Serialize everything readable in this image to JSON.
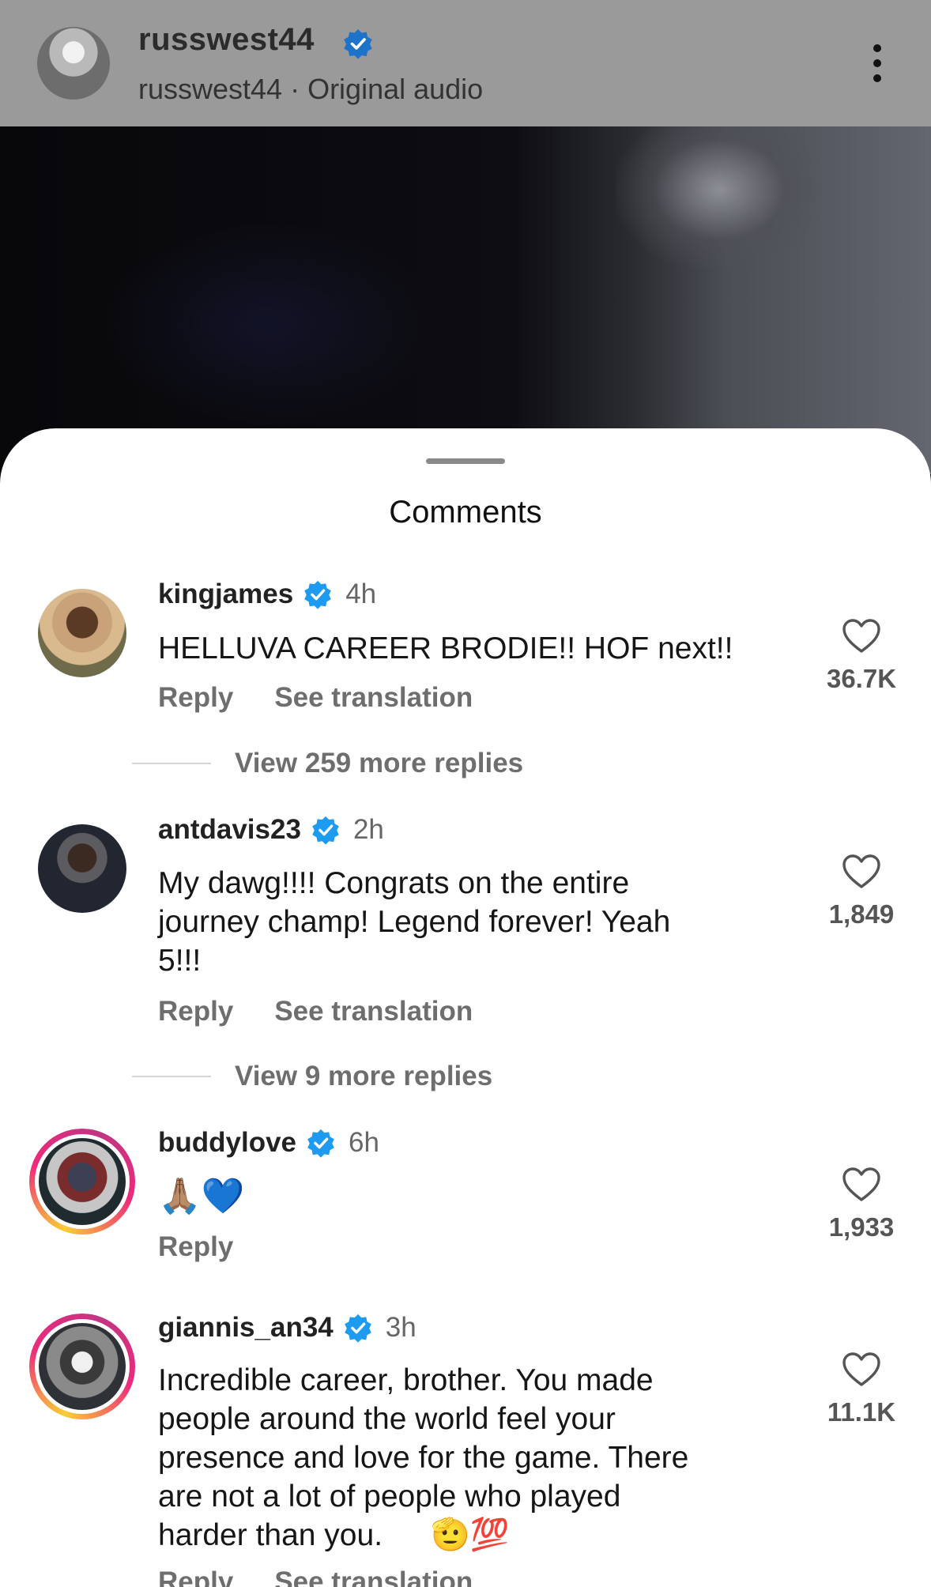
{
  "header": {
    "username": "russwest44",
    "subtitle": "russwest44 · Original audio"
  },
  "sheet": {
    "title": "Comments"
  },
  "comments": [
    {
      "username": "kingjames",
      "time": "4h",
      "text": "HELLUVA CAREER BRODIE!! HOF next!!",
      "reply_label": "Reply",
      "translate_label": "See translation",
      "likes": "36.7K",
      "view_replies": "View 259 more replies"
    },
    {
      "username": "antdavis23",
      "time": "2h",
      "text": "My dawg!!!! Congrats on the entire\njourney champ! Legend forever! Yeah\n5!!!",
      "reply_label": "Reply",
      "translate_label": "See translation",
      "likes": "1,849",
      "view_replies": "View 9 more replies"
    },
    {
      "username": "buddylove",
      "time": "6h",
      "text_emoji": "🙏🏽💙",
      "reply_label": "Reply",
      "likes": "1,933"
    },
    {
      "username": "giannis_an34",
      "time": "3h",
      "text": "Incredible career, brother. You made\npeople around the world feel your\npresence and love for the game. There\nare not a lot of people who played\nharder than you.",
      "text_emoji": "🫡💯",
      "reply_label": "Reply",
      "translate_label": "See translation",
      "likes": "11.1K"
    }
  ],
  "colors": {
    "verified": "#1d9bf0",
    "story_ring": "#ee2a7b"
  },
  "icons": [
    "verified-badge-icon",
    "more-vertical-icon",
    "heart-outline-icon"
  ]
}
